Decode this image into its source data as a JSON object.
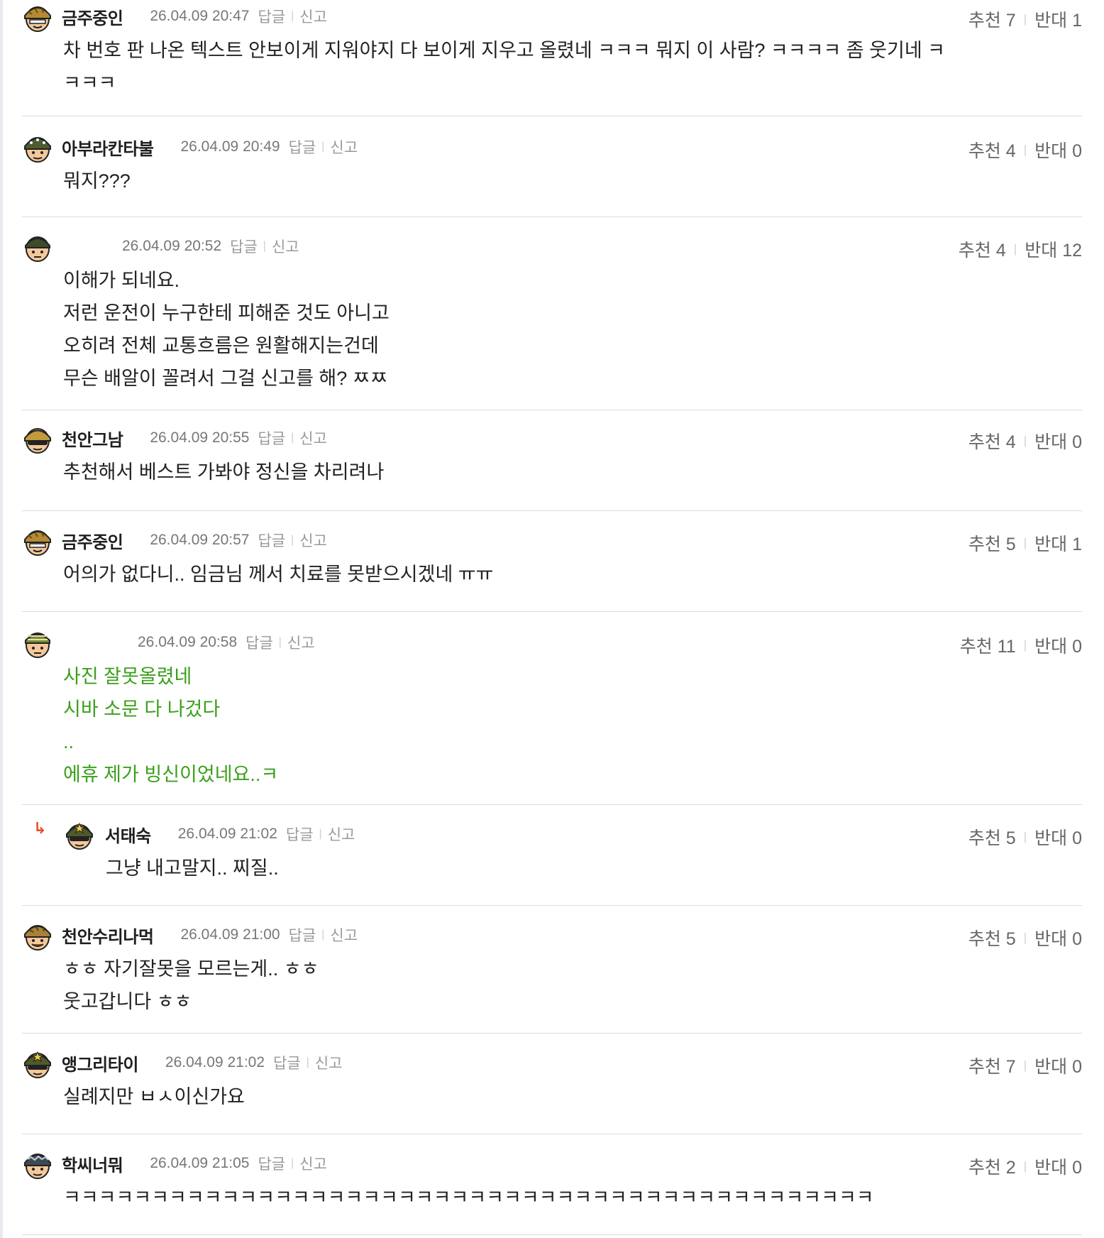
{
  "comments": [
    {
      "author": "금주중인",
      "date": "26.04.09 20:47",
      "reply_label": "답글",
      "report_label": "신고",
      "up_label": "추천",
      "up": "7",
      "down_label": "반대",
      "down": "1",
      "lines": [
        "차 번호 판 나온 텍스트 안보이게 지워야지 다 보이게 지우고 올렸네 ㅋㅋㅋ 뭐지 이 사람? ㅋㅋㅋㅋ 좀 웃기네 ㅋ",
        "ㅋㅋㅋ"
      ]
    },
    {
      "author": "아부라칸타불",
      "date": "26.04.09 20:49",
      "reply_label": "답글",
      "report_label": "신고",
      "up_label": "추천",
      "up": "4",
      "down_label": "반대",
      "down": "0",
      "lines": [
        "뭐지???"
      ]
    },
    {
      "author": "",
      "date": "26.04.09 20:52",
      "reply_label": "답글",
      "report_label": "신고",
      "up_label": "추천",
      "up": "4",
      "down_label": "반대",
      "down": "12",
      "lines": [
        "이해가 되네요.",
        "저런 운전이 누구한테 피해준 것도 아니고",
        "오히려 전체 교통흐름은 원활해지는건데",
        "무슨 배알이 꼴려서 그걸 신고를 해? ㅉㅉ"
      ]
    },
    {
      "author": "천안그남",
      "date": "26.04.09 20:55",
      "reply_label": "답글",
      "report_label": "신고",
      "up_label": "추천",
      "up": "4",
      "down_label": "반대",
      "down": "0",
      "lines": [
        "추천해서 베스트 가봐야 정신을 차리려나"
      ]
    },
    {
      "author": "금주중인",
      "date": "26.04.09 20:57",
      "reply_label": "답글",
      "report_label": "신고",
      "up_label": "추천",
      "up": "5",
      "down_label": "반대",
      "down": "1",
      "lines": [
        "어의가 없다니.. 임금님 께서 치료를 못받으시겠네 ㅠㅠ"
      ]
    },
    {
      "author": "",
      "date": "26.04.09 20:58",
      "reply_label": "답글",
      "report_label": "신고",
      "up_label": "추천",
      "up": "11",
      "down_label": "반대",
      "down": "0",
      "lines": [
        "사진 잘못올렸네",
        "시바 소문 다 나겄다",
        "..",
        "에휴 제가 빙신이었네요..ㅋ"
      ]
    },
    {
      "author": "서태숙",
      "date": "26.04.09 21:02",
      "reply_label": "답글",
      "report_label": "신고",
      "up_label": "추천",
      "up": "5",
      "down_label": "반대",
      "down": "0",
      "lines": [
        "그냥 내고말지.. 찌질.."
      ]
    },
    {
      "author": "천안수리나먹",
      "date": "26.04.09 21:00",
      "reply_label": "답글",
      "report_label": "신고",
      "up_label": "추천",
      "up": "5",
      "down_label": "반대",
      "down": "0",
      "lines": [
        "ㅎㅎ 자기잘못을 모르는게.. ㅎㅎ",
        "웃고갑니다 ㅎㅎ"
      ]
    },
    {
      "author": "앵그리타이",
      "date": "26.04.09 21:02",
      "reply_label": "답글",
      "report_label": "신고",
      "up_label": "추천",
      "up": "7",
      "down_label": "반대",
      "down": "0",
      "lines": [
        "실례지만 ㅂㅅ이신가요"
      ]
    },
    {
      "author": "학씨너뭐",
      "date": "26.04.09 21:05",
      "reply_label": "답글",
      "report_label": "신고",
      "up_label": "추천",
      "up": "2",
      "down_label": "반대",
      "down": "0",
      "lines": [
        "ㅋㅋㅋㅋㅋㅋㅋㅋㅋㅋㅋㅋㅋㅋㅋㅋㅋㅋㅋㅋㅋㅋㅋㅋㅋㅋㅋㅋㅋㅋㅋㅋㅋㅋㅋㅋㅋㅋㅋㅋㅋㅋㅋㅋㅋㅋ"
      ]
    }
  ],
  "icons": {
    "reply_arrow": "reply-arrow-icon",
    "avatar": "soldier-avatar-icon"
  },
  "colors": {
    "highlight_text": "#3aa01a",
    "reply_arrow": "#e8502a",
    "author_text": "#1e1e1e",
    "meta_text": "#777777"
  }
}
